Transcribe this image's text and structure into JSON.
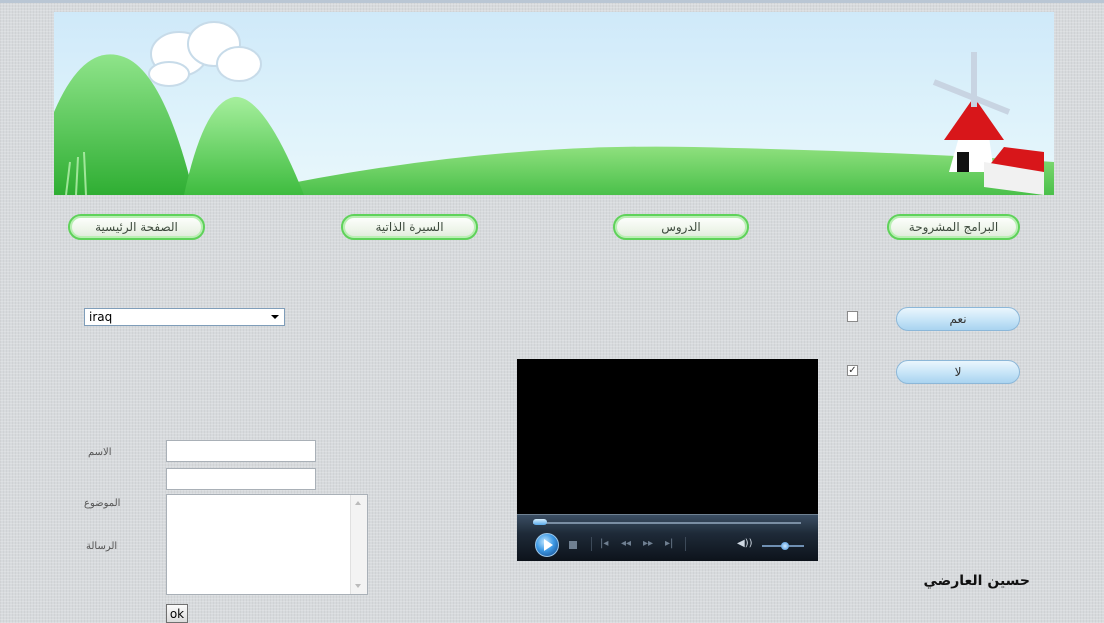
{
  "nav": {
    "home": "الصفحة الرئيسية",
    "cv": "السيرة الذاتية",
    "lessons": "الدروس",
    "projects": "البرامج المشروحة"
  },
  "country_select": {
    "selected": "iraq"
  },
  "options": {
    "yes_label": "نعم",
    "no_label": "لا",
    "yes_checked": false,
    "no_checked": true,
    "check_glyph": "✓"
  },
  "form": {
    "name_label": "الاسم",
    "subject_label": "الموضوع",
    "message_label": "الرسالة",
    "submit_label": "ok"
  },
  "author": "حسين العارضي",
  "colors": {
    "nav_border": "#5fd25a",
    "background": "#d7dadd",
    "pill_button": "#c9e6f8"
  },
  "icons": {
    "play": "play-icon",
    "stop": "stop-icon",
    "prev": "previous-icon",
    "rewind": "rewind-icon",
    "forward": "fast-forward-icon",
    "next": "next-icon",
    "volume": "speaker-icon"
  }
}
